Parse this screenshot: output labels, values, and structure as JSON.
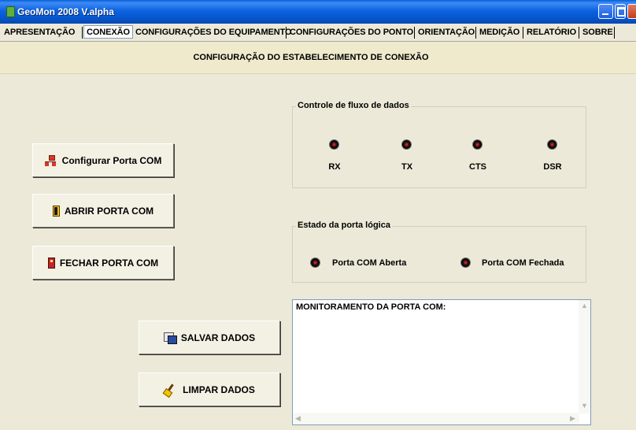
{
  "window": {
    "title": "GeoMon 2008 V.alpha"
  },
  "tabs": [
    {
      "label": "APRESENTAÇÃO"
    },
    {
      "label": "CONEXÃO"
    },
    {
      "label": "CONFIGURAÇÕES DO EQUIPAMENTO"
    },
    {
      "label": "CONFIGURAÇÕES DO PONTO"
    },
    {
      "label": "ORIENTAÇÃO"
    },
    {
      "label": "MEDIÇÃO"
    },
    {
      "label": "RELATÓRIO"
    },
    {
      "label": "SOBRE"
    }
  ],
  "active_tab": "CONEXÃO",
  "header": {
    "title": "CONFIGURAÇÃO DO ESTABELECIMENTO DE CONEXÃO"
  },
  "buttons": {
    "configure": {
      "label": "Configurar Porta COM",
      "icon": "network-icon"
    },
    "open": {
      "label": "ABRIR PORTA COM",
      "icon": "door-open-icon"
    },
    "close": {
      "label": "FECHAR PORTA COM",
      "icon": "door-closed-icon"
    },
    "save": {
      "label": "SALVAR DADOS",
      "icon": "save-icon"
    },
    "clear": {
      "label": "LIMPAR DADOS",
      "icon": "broom-icon"
    }
  },
  "flow_control": {
    "title": "Controle de fluxo de dados",
    "signals": [
      "RX",
      "TX",
      "CTS",
      "DSR"
    ]
  },
  "port_state": {
    "title": "Estado da porta lógica",
    "open_label": "Porta COM Aberta",
    "closed_label": "Porta COM Fechada"
  },
  "monitor": {
    "text": "MONITORAMENTO DA PORTA COM:"
  },
  "colors": {
    "titlebar": "#0a5fd8",
    "background": "#ece9d8",
    "header": "#efeacc",
    "led": "#c62020"
  }
}
